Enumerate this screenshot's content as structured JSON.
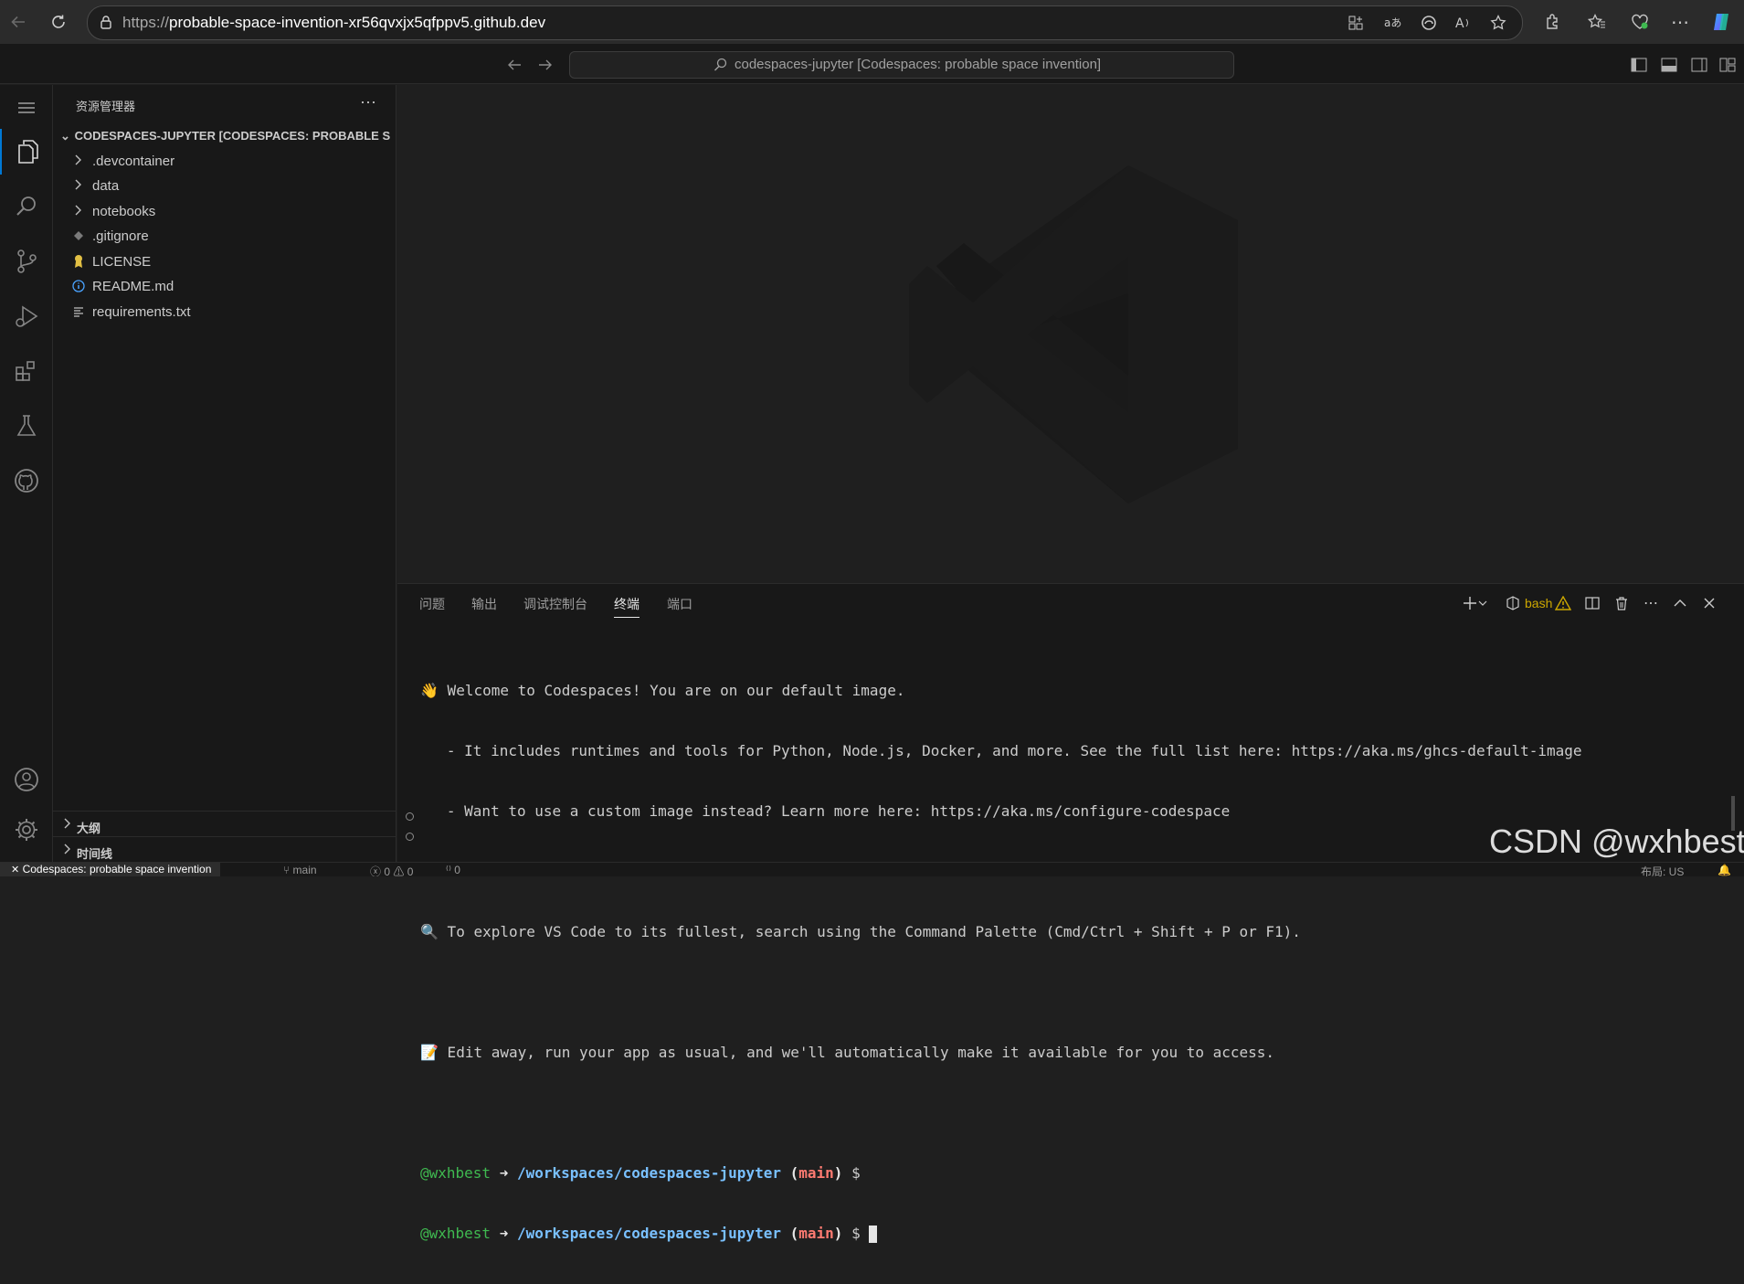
{
  "browser": {
    "url_protocol": "https://",
    "url_host": "probable-space-invention-xr56qvxjx5qfppv5.github.dev"
  },
  "titlebar": {
    "search_text": "codespaces-jupyter [Codespaces: probable space invention]"
  },
  "sidebar": {
    "title": "资源管理器",
    "more": "···",
    "root_folder": "CODESPACES-JUPYTER [CODESPACES: PROBABLE S...",
    "items": [
      {
        "label": ".devcontainer",
        "kind": "folder"
      },
      {
        "label": "data",
        "kind": "folder"
      },
      {
        "label": "notebooks",
        "kind": "folder"
      },
      {
        "label": ".gitignore",
        "kind": "file"
      },
      {
        "label": "LICENSE",
        "kind": "file"
      },
      {
        "label": "README.md",
        "kind": "file"
      },
      {
        "label": "requirements.txt",
        "kind": "file"
      }
    ],
    "outline": "大纲",
    "timeline": "时间线"
  },
  "panel": {
    "tabs": [
      "问题",
      "输出",
      "调试控制台",
      "终端",
      "端口"
    ],
    "active_tab": "终端",
    "shell": "bash",
    "terminal": {
      "welcome": "👋 Welcome to Codespaces! You are on our default image.",
      "line1": "   - It includes runtimes and tools for Python, Node.js, Docker, and more. See the full list here: https://aka.ms/ghcs-default-image",
      "line2": "   - Want to use a custom image instead? Learn more here: https://aka.ms/configure-codespace",
      "explore": "🔍 To explore VS Code to its fullest, search using the Command Palette (Cmd/Ctrl + Shift + P or F1).",
      "edit": "📝 Edit away, run your app as usual, and we'll automatically make it available for you to access.",
      "user": "@wxhbest",
      "arrow": "➜",
      "path": "/workspaces/codespaces-jupyter",
      "branch_open": "(",
      "branch": "main",
      "branch_close": ")",
      "dollar": "$"
    }
  },
  "statusbar": {
    "remote": "Codespaces: probable space invention",
    "branch": "main",
    "errors": "0",
    "warnings": "0",
    "ports": "0",
    "layout": "布局: US"
  },
  "watermark": "CSDN @wxhbest",
  "colors": {
    "accent": "#0078d4",
    "background": "#1f1f1f",
    "sidebar": "#181818",
    "terminal_user": "#3fb950",
    "terminal_path": "#79c0ff",
    "terminal_branch": "#ff7b72",
    "shell_warning": "#cca700"
  }
}
